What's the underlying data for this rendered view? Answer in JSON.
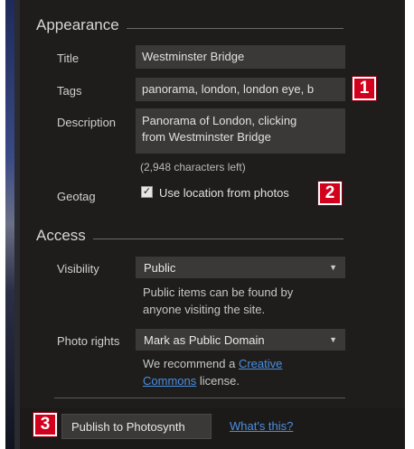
{
  "appearance": {
    "heading": "Appearance",
    "title_label": "Title",
    "title_value": "Westminster Bridge",
    "tags_label": "Tags",
    "tags_value": "panorama, london, london eye, b",
    "description_label": "Description",
    "description_line1": "Panorama of London, clicking",
    "description_line2": "from Westminster Bridge",
    "chars_left": "(2,948 characters left)",
    "geotag_label": "Geotag",
    "geotag_checkbox_label": "Use location from photos",
    "geotag_checked": true
  },
  "access": {
    "heading": "Access",
    "visibility_label": "Visibility",
    "visibility_value": "Public",
    "visibility_hint_line1": "Public items can be found by",
    "visibility_hint_line2": "anyone visiting the site.",
    "rights_label": "Photo rights",
    "rights_value": "Mark as Public Domain",
    "rights_hint_prefix": "We recommend a ",
    "rights_hint_link_line1": "Creative",
    "rights_hint_link_line2": "Commons",
    "rights_hint_suffix": " license."
  },
  "footer": {
    "publish_label": "Publish to Photosynth",
    "whats_this_label": "What's this?"
  },
  "callouts": {
    "one": "1",
    "two": "2",
    "three": "3"
  },
  "colors": {
    "panel_bg": "#1e1d1c",
    "field_bg": "#3a3938",
    "link": "#4b8fe0",
    "callout_red": "#d2001c"
  }
}
